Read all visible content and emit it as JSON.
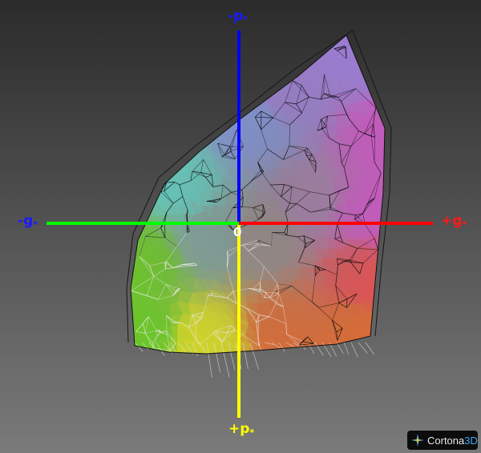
{
  "viewer": {
    "brand": {
      "name": "Cortona",
      "suffix": "3D",
      "icon": "cortona-star-icon"
    },
    "background": {
      "top": "#2b2b2b",
      "bottom": "#7a7a7a"
    }
  },
  "axes": {
    "origin": {
      "text": "0",
      "color": "#ffffff"
    },
    "top": {
      "sign": "-",
      "letter": "p",
      "sub": "*",
      "color": "#1a1aff"
    },
    "bottom": {
      "sign": "+",
      "letter": "p",
      "sub": "*",
      "color": "#ffff00"
    },
    "left": {
      "sign": "-",
      "letter": "g",
      "sub": "*",
      "color": "#1a1aff"
    },
    "right": {
      "sign": "+",
      "letter": "g",
      "sub": "*",
      "color": "#ff1a1a"
    },
    "line_colors": {
      "up": "#0000ff",
      "down": "#ffff00",
      "left": "#00ff00",
      "right": "#ff0000"
    }
  },
  "gamut": {
    "colors": {
      "magenta": "#d94fd0",
      "violet": "#a27be6",
      "blue": "#7f97f2",
      "cyan": "#5fd4c6",
      "green": "#6cc62a",
      "yellow": "#d8dc22",
      "orange": "#e2692e",
      "red": "#ef4a4d"
    }
  }
}
